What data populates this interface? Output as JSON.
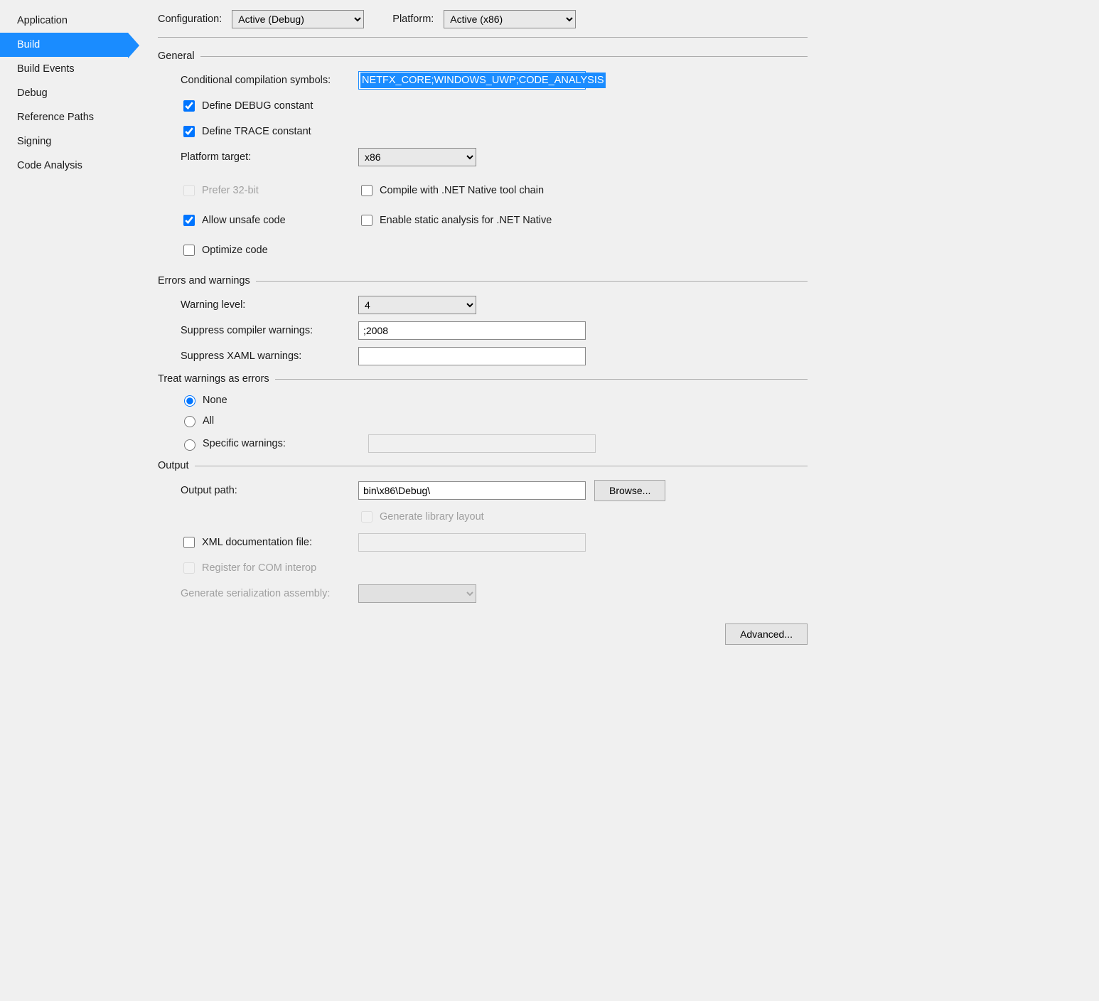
{
  "sidebar": {
    "items": [
      {
        "label": "Application"
      },
      {
        "label": "Build"
      },
      {
        "label": "Build Events"
      },
      {
        "label": "Debug"
      },
      {
        "label": "Reference Paths"
      },
      {
        "label": "Signing"
      },
      {
        "label": "Code Analysis"
      }
    ],
    "selected": 1
  },
  "config": {
    "configuration_label": "Configuration:",
    "configuration_value": "Active (Debug)",
    "platform_label": "Platform:",
    "platform_value": "Active (x86)"
  },
  "general": {
    "header": "General",
    "symbols_label": "Conditional compilation symbols:",
    "symbols_value": "NETFX_CORE;WINDOWS_UWP;CODE_ANALYSIS",
    "define_debug": "Define DEBUG constant",
    "define_trace": "Define TRACE constant",
    "platform_target_label": "Platform target:",
    "platform_target_value": "x86",
    "prefer_32bit": "Prefer 32-bit",
    "compile_net_native": "Compile with .NET Native tool chain",
    "allow_unsafe": "Allow unsafe code",
    "enable_static_analysis": "Enable static analysis for .NET Native",
    "optimize_code": "Optimize code"
  },
  "errors": {
    "header": "Errors and warnings",
    "warning_level_label": "Warning level:",
    "warning_level_value": "4",
    "suppress_compiler_label": "Suppress compiler warnings:",
    "suppress_compiler_value": ";2008",
    "suppress_xaml_label": "Suppress XAML warnings:",
    "suppress_xaml_value": ""
  },
  "treat": {
    "header": "Treat warnings as errors",
    "none": "None",
    "all": "All",
    "specific": "Specific warnings:"
  },
  "output": {
    "header": "Output",
    "path_label": "Output path:",
    "path_value": "bin\\x86\\Debug\\",
    "browse": "Browse...",
    "gen_library": "Generate library layout",
    "xml_doc": "XML documentation file:",
    "register_com": "Register for COM interop",
    "gen_serialization": "Generate serialization assembly:"
  },
  "advanced": "Advanced..."
}
